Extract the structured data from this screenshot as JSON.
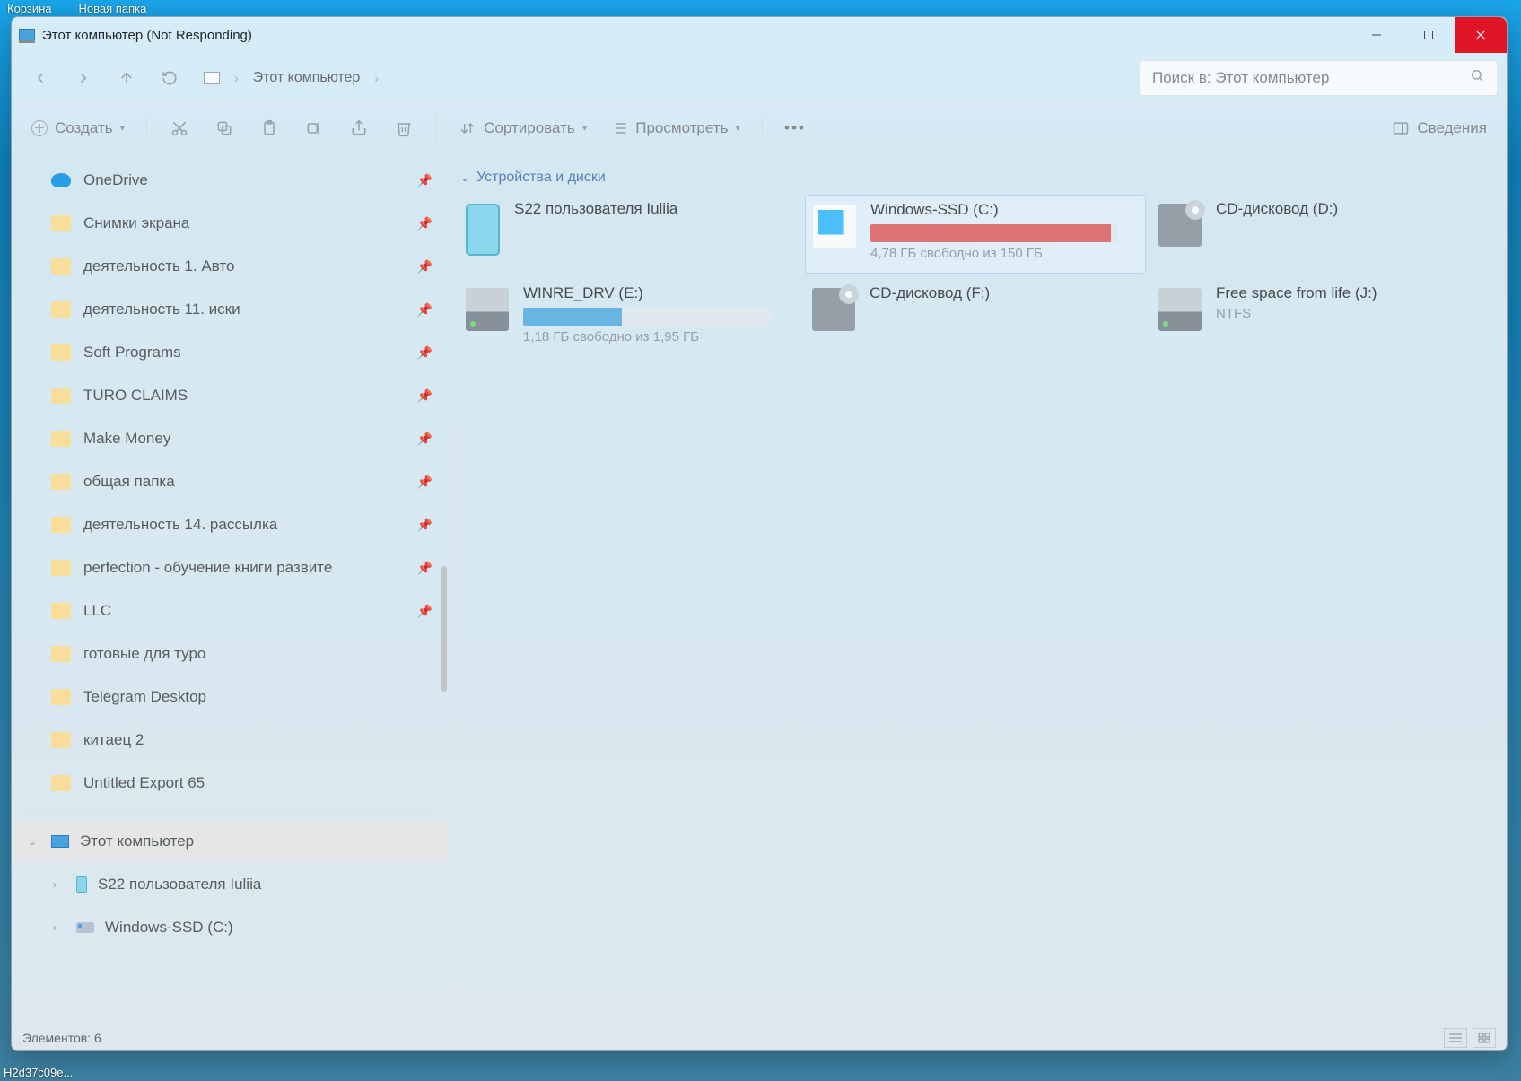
{
  "desktop": {
    "icons": [
      "Корзина",
      "Новая папка"
    ]
  },
  "window": {
    "title": "Этот компьютер (Not Responding)"
  },
  "address": {
    "crumb": "Этот компьютер"
  },
  "search": {
    "placeholder": "Поиск в: Этот компьютер"
  },
  "toolbar": {
    "create": "Создать",
    "sort": "Сортировать",
    "view": "Просмотреть",
    "details": "Сведения"
  },
  "sidebar": {
    "items": [
      {
        "label": "OneDrive",
        "type": "onedrive",
        "pinned": true
      },
      {
        "label": "Снимки экрана",
        "type": "folder",
        "pinned": true
      },
      {
        "label": "деятельность 1. Авто",
        "type": "folder",
        "pinned": true
      },
      {
        "label": "деятельность 11. иски",
        "type": "folder",
        "pinned": true
      },
      {
        "label": "Soft Programs",
        "type": "folder",
        "pinned": true
      },
      {
        "label": "TURO CLAIMS",
        "type": "folder",
        "pinned": true
      },
      {
        "label": "Make Money",
        "type": "folder",
        "pinned": true
      },
      {
        "label": "общая папка",
        "type": "folder",
        "pinned": true
      },
      {
        "label": "деятельность 14. рассылка",
        "type": "folder",
        "pinned": true
      },
      {
        "label": "perfection - обучение книги развите",
        "type": "folder",
        "pinned": true
      },
      {
        "label": "LLC",
        "type": "folder",
        "pinned": true
      },
      {
        "label": "готовые для туро",
        "type": "folder",
        "pinned": false
      },
      {
        "label": "Telegram Desktop",
        "type": "folder",
        "pinned": false
      },
      {
        "label": "китаец 2",
        "type": "folder",
        "pinned": false
      },
      {
        "label": "Untitled Export 65",
        "type": "folder",
        "pinned": false
      }
    ],
    "tree": [
      {
        "label": "Этот компьютер",
        "icon": "pc",
        "expanded": true,
        "selected": true
      },
      {
        "label": "S22 пользователя Iuliia",
        "icon": "phone",
        "expanded": false,
        "indent": 1
      },
      {
        "label": "Windows-SSD (C:)",
        "icon": "drive",
        "expanded": false,
        "indent": 1
      }
    ]
  },
  "main": {
    "section": "Устройства и диски",
    "drives": [
      {
        "name": "S22 пользователя Iuliia",
        "icon": "phone",
        "bar": null,
        "sub": ""
      },
      {
        "name": "Windows-SSD (C:)",
        "icon": "winlogo",
        "bar": {
          "pct": 97,
          "color": "#e57373"
        },
        "sub": "4,78 ГБ свободно из 150 ГБ",
        "selected": true
      },
      {
        "name": "CD-дисковод (D:)",
        "icon": "cd",
        "bar": null,
        "sub": ""
      },
      {
        "name": "WINRE_DRV (E:)",
        "icon": "hdd",
        "bar": {
          "pct": 40,
          "color": "#6bb7e6"
        },
        "sub": "1,18 ГБ свободно из 1,95 ГБ"
      },
      {
        "name": "CD-дисковод (F:)",
        "icon": "cd",
        "bar": null,
        "sub": ""
      },
      {
        "name": "Free space from life (J:)",
        "icon": "hdd",
        "bar": null,
        "sub": "NTFS"
      }
    ]
  },
  "status": {
    "text": "Элементов: 6"
  },
  "taskbar": {
    "hint": "H2d37c09e..."
  }
}
